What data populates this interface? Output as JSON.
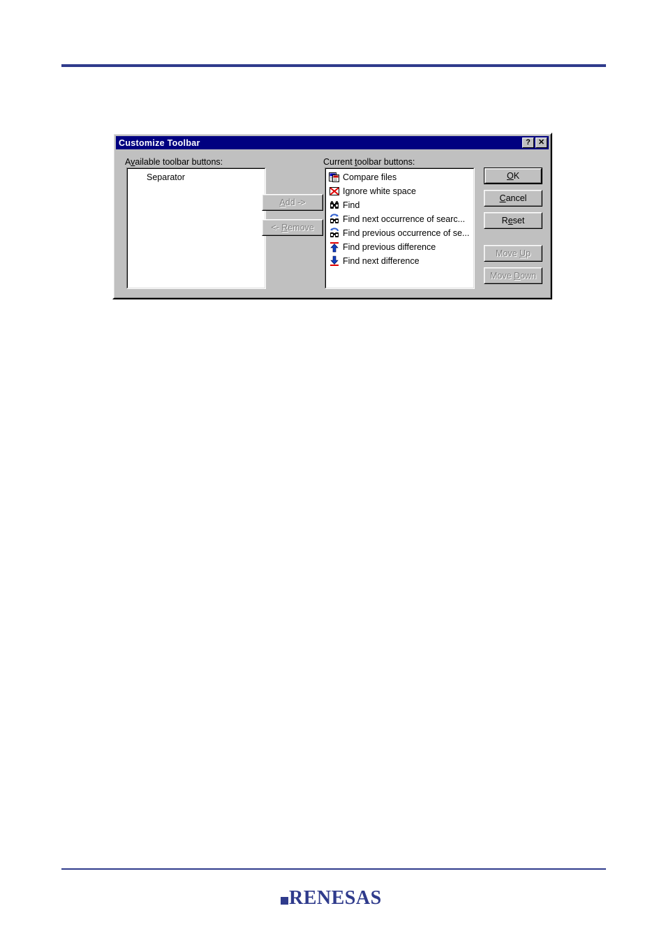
{
  "page": {
    "rule_color": "#2f3b8c",
    "logo_text": "ENESAS",
    "logo_initial": "R"
  },
  "dialog": {
    "title": "Customize Toolbar",
    "titlebar_color": "#000080",
    "face_color": "#c0c0c0",
    "help_button": "?",
    "close_button": "✕",
    "available": {
      "label_pre": "A",
      "label_accel": "v",
      "label_post": "ailable toolbar buttons:",
      "items": [
        {
          "label": "Separator",
          "icon": "none"
        }
      ]
    },
    "current": {
      "label_pre": "Current ",
      "label_accel": "t",
      "label_post": "oolbar buttons:",
      "items": [
        {
          "label": "Compare files",
          "icon": "compare-files-icon"
        },
        {
          "label": "Ignore white space",
          "icon": "ignore-white-space-icon"
        },
        {
          "label": "Find",
          "icon": "find-binoculars-icon"
        },
        {
          "label": "Find next occurrence of searc...",
          "icon": "find-next-occurrence-icon"
        },
        {
          "label": "Find previous occurrence of se...",
          "icon": "find-previous-occurrence-icon"
        },
        {
          "label": "Find previous difference",
          "icon": "arrow-up-icon"
        },
        {
          "label": "Find next difference",
          "icon": "arrow-down-icon"
        }
      ]
    },
    "buttons": {
      "add": {
        "pre": "",
        "accel": "A",
        "post": "dd ->",
        "enabled": false
      },
      "remove": {
        "pre": "<- ",
        "accel": "R",
        "post": "emove",
        "enabled": false
      },
      "ok": {
        "pre": "",
        "accel": "O",
        "post": "K",
        "enabled": true,
        "default": true
      },
      "cancel": {
        "pre": "",
        "accel": "C",
        "post": "ancel",
        "enabled": true
      },
      "reset": {
        "pre": "R",
        "accel": "e",
        "post": "set",
        "enabled": true
      },
      "move_up": {
        "pre": "Move ",
        "accel": "U",
        "post": "p",
        "enabled": false
      },
      "move_down": {
        "pre": "Move ",
        "accel": "D",
        "post": "own",
        "enabled": false
      }
    }
  }
}
